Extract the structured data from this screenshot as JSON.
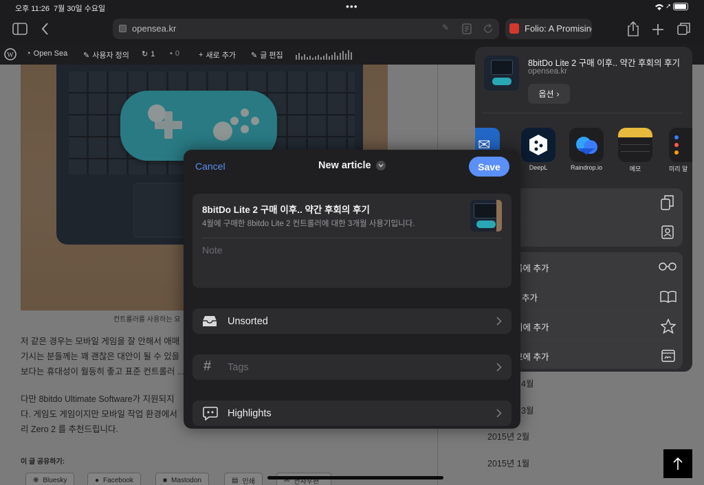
{
  "status": {
    "time": "오후 11:26",
    "date": "7월 30일 수요일"
  },
  "browser": {
    "url": "opensea.kr",
    "tab2_title": "Folio: A Promising"
  },
  "wp_toolbar": {
    "site": "Open Sea",
    "customize": "사용자 정의",
    "updates": "1",
    "comments": "0",
    "new": "새로 추가",
    "edit": "글 편집"
  },
  "article": {
    "caption": "컨트롤러를 사용하는 요",
    "para1": [
      "저 같은 경우는 모바일 게임을 잘 안해서 애매",
      "기시는 분들께는 꽤 괜찮은 대안이 될 수 있을",
      "보다는 휴대성이 월등히 좋고 표준 컨트롤러 ..."
    ],
    "para2": [
      "다만 8bitdo Ultimate Software가 지원되지",
      "다. 게임도 게임이지만 모바일 작업 환경에서",
      "리 Zero 2 를 추천드립니다."
    ],
    "share_heading": "이 글 공유하기:",
    "share_buttons": [
      "Bluesky",
      "Facebook",
      "Mastodon",
      "인쇄",
      "전자우편"
    ]
  },
  "sidebar_archive": [
    "4월",
    "3월",
    "2015년 2월",
    "2015년 1월"
  ],
  "share_sheet": {
    "title": "8bitDo Lite 2 구매 이후.. 약간 후회의 후기",
    "domain": "opensea.kr",
    "options_label": "옵션",
    "apps": [
      "DeepL",
      "Raindrop.io",
      "메모",
      "미리 알"
    ],
    "actions": [
      "록에 추가",
      "추가",
      "기에 추가",
      "모에 추가"
    ]
  },
  "modal": {
    "cancel": "Cancel",
    "title": "New article",
    "save": "Save",
    "item_title": "8bitDo Lite 2 구매 이후.. 약간 후회의 후기",
    "item_desc": "4월에 구매한 8bitdo Lite 2 컨트롤러에 대한 3개월 사용기입니다.",
    "note_placeholder": "Note",
    "collection": "Unsorted",
    "tags_placeholder": "Tags",
    "highlights": "Highlights"
  },
  "colors": {
    "accent": "#5b8ff9",
    "cancel_blue": "#5a8ff0"
  }
}
